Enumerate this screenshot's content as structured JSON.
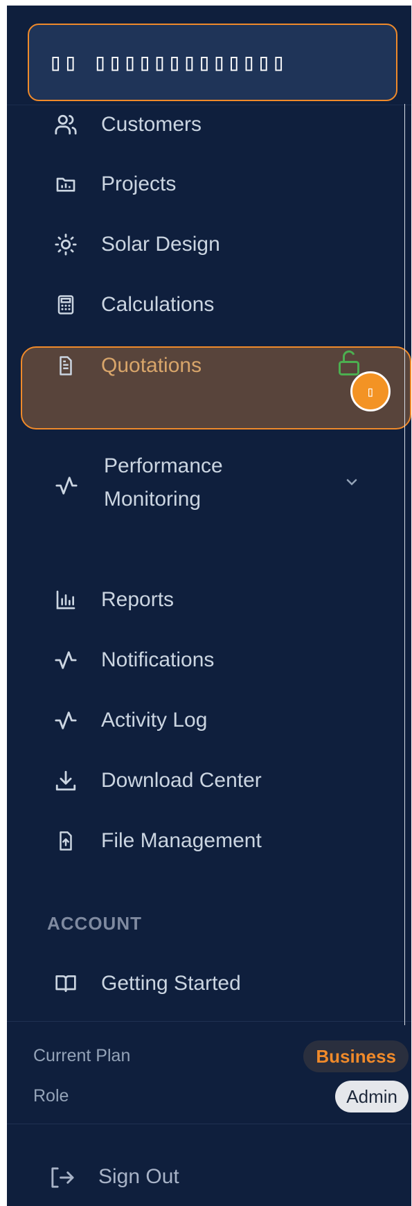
{
  "top": {
    "tooltip_text": "▯▯ ▯▯▯▯▯▯▯▯▯▯▯▯▯"
  },
  "nav": {
    "items": [
      {
        "label": "Customers",
        "icon": "users-icon"
      },
      {
        "label": "Projects",
        "icon": "folder-chart-icon"
      },
      {
        "label": "Solar Design",
        "icon": "sun-icon"
      },
      {
        "label": "Calculations",
        "icon": "calculator-icon"
      },
      {
        "label": "Quotations",
        "icon": "document-icon"
      },
      {
        "label_line1": "Performance",
        "label_line2": "Monitoring",
        "icon": "activity-icon"
      },
      {
        "label": "Reports",
        "icon": "bar-chart-icon"
      },
      {
        "label": "Notifications",
        "icon": "activity-icon"
      },
      {
        "label": "Activity Log",
        "icon": "activity-icon"
      },
      {
        "label": "Download Center",
        "icon": "download-icon"
      },
      {
        "label": "File Management",
        "icon": "file-upload-icon"
      }
    ],
    "quotations_badge": "▯"
  },
  "account": {
    "heading": "ACCOUNT",
    "getting_started": "Getting Started"
  },
  "footer": {
    "current_plan_label": "Current Plan",
    "current_plan_value": "Business",
    "role_label": "Role",
    "role_value": "Admin",
    "sign_out": "Sign Out"
  },
  "colors": {
    "sidebar_bg": "#0f1f3d",
    "accent_orange": "#f08a2a",
    "text_muted": "#cbd5e1",
    "lock_green": "#4caf50"
  }
}
